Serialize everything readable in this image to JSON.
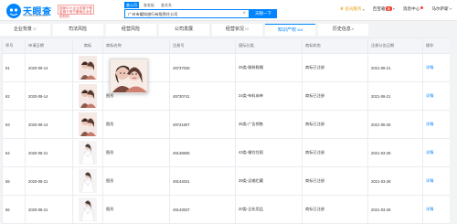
{
  "header": {
    "logo_text": "天眼查",
    "logo_sub": "TianYanCha.com",
    "official_badge": "国家中小企业发展子基金旗下官方备案企业征信机构",
    "search_tabs": [
      "查公司",
      "查老板",
      "查关系"
    ],
    "search_value": "广州市耀知旅行有限责任公司",
    "search_button": "天眼一下",
    "nav": {
      "vip": "会员服务",
      "baibao": "百宝箱",
      "baibao_badge": "新",
      "messages": "消息中心",
      "user": "马尔萨斯"
    }
  },
  "tabs": [
    {
      "label": "企业背景",
      "count": "37"
    },
    {
      "label": "司法风险",
      "count": ""
    },
    {
      "label": "经营风险",
      "count": ""
    },
    {
      "label": "公司发展",
      "count": ""
    },
    {
      "label": "经营状况",
      "count": "22"
    },
    {
      "label": "知识产权",
      "count": "118"
    },
    {
      "label": "历史信息",
      "count": "6"
    }
  ],
  "table": {
    "headers": [
      "序号",
      "申请日期",
      "商标",
      "商标名称",
      "注册号",
      "国际分类",
      "商标状态",
      "注册公告日期",
      "操作"
    ],
    "rows": [
      {
        "idx": "61",
        "date": "2020-09-14",
        "name": "",
        "reg": "49737026",
        "cls": "25类-服装鞋帽",
        "status": "商标已注册",
        "pub": "2021-06-21",
        "op": "详情"
      },
      {
        "idx": "62",
        "date": "2020-09-14",
        "name": "图形",
        "reg": "49730741",
        "cls": "24类-布料床单",
        "status": "商标已注册",
        "pub": "2021-06-21",
        "op": "详情"
      },
      {
        "idx": "63",
        "date": "2020-09-14",
        "name": "图形",
        "reg": "49731607",
        "cls": "35类-广告销售",
        "status": "商标已注册",
        "pub": "2021-05-28",
        "op": "详情"
      },
      {
        "idx": "64",
        "date": "2020-08-21",
        "name": "图形",
        "reg": "49138606",
        "cls": "43类-餐饮住宿",
        "status": "商标已注册",
        "pub": "2021-03-28",
        "op": "详情"
      },
      {
        "idx": "65",
        "date": "2020-08-21",
        "name": "图形",
        "reg": "49144041",
        "cls": "39类-运输贮藏",
        "status": "商标已注册",
        "pub": "2021-03-28",
        "op": "详情"
      },
      {
        "idx": "66",
        "date": "2020-08-21",
        "name": "图形",
        "reg": "49143037",
        "cls": "20类-日化用品",
        "status": "商标已注册",
        "pub": "2021-03-28",
        "op": "详情"
      }
    ]
  },
  "colors": {
    "accent": "#0084ff",
    "badge_red": "#f04134",
    "vip_gold": "#e8a317"
  }
}
